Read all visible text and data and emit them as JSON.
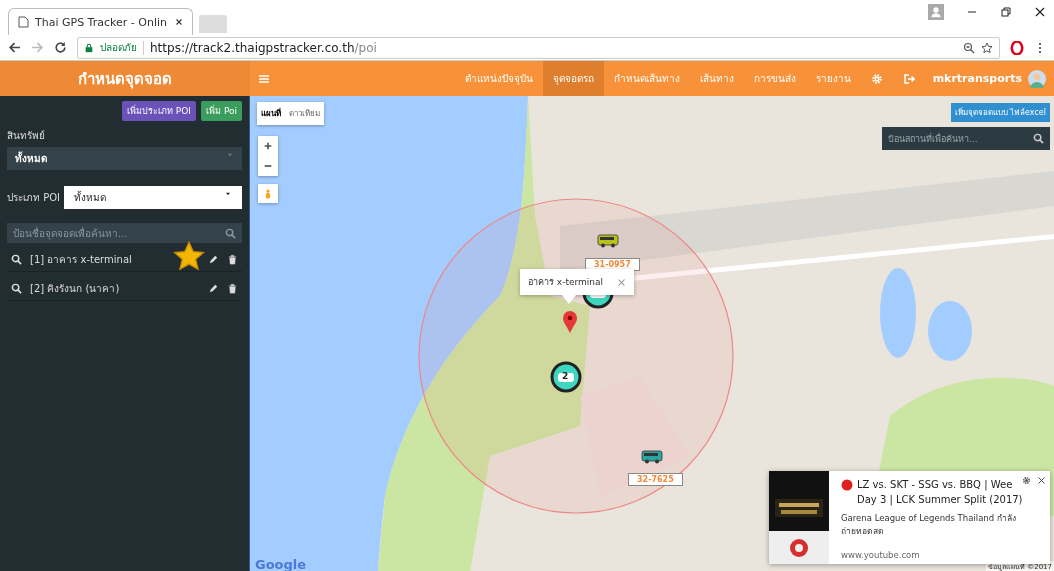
{
  "browser": {
    "tab_title": "Thai GPS Tracker - Onlin",
    "security_label": "ปลอดภัย",
    "url_host": "https://track2.thaigpstracker.co.th",
    "url_path": "/poi"
  },
  "header": {
    "title": "กำหนดจุดจอด",
    "user": "mkrtransports",
    "nav": [
      {
        "label": "ตำแหน่งปัจจุบัน",
        "selected": false
      },
      {
        "label": "จุดจอดรถ",
        "selected": true
      },
      {
        "label": "กำหนดเส้นทาง",
        "selected": false
      },
      {
        "label": "เส้นทาง",
        "selected": false
      },
      {
        "label": "การขนส่ง",
        "selected": false
      },
      {
        "label": "รายงาน",
        "selected": false
      }
    ]
  },
  "sidebar": {
    "buttons": [
      {
        "label": "เพิ่มประเภท POI",
        "color": "#6a52b8"
      },
      {
        "label": "เพิ่ม Poi",
        "color": "#3a9d5d"
      }
    ],
    "asset_label": "สินทรัพย์",
    "asset_value": "ทั้งหมด",
    "poi_type_label": "ประเภท POI",
    "poi_type_value": "ทั้งหมด",
    "search_placeholder": "ป้อนชื่อจุดจอดเพื่อค้นหา...",
    "items": [
      {
        "label": "[1] อาคาร x-terminal",
        "starred": true
      },
      {
        "label": "[2] คิงรังนก (นาคา)",
        "starred": false
      }
    ]
  },
  "map": {
    "type_tabs": [
      {
        "label": "แผนที่",
        "selected": true
      },
      {
        "label": "ดาวเทียม",
        "selected": false
      }
    ],
    "import_button": "เพิ่มจุดจอดแบบ ไฟล์excel",
    "search_placeholder": "ป้อนสถานที่เพื่อค้นหา...",
    "popup": "อาคาร x-terminal",
    "vehicles": [
      {
        "kind": "bus",
        "plate": "31-0957"
      },
      {
        "kind": "car"
      },
      {
        "kind": "car",
        "count": "2"
      },
      {
        "kind": "bus",
        "plate": "32-7625"
      }
    ],
    "logo": "Google",
    "attribution": "ข้อมูลแผนที่ ©2017"
  },
  "notification": {
    "title_lines": [
      "LZ vs. SKT - SSG vs. BBQ | Wee",
      "Day 3 | LCK Summer Split (2017)"
    ],
    "body": "Garena League of Legends Thailand กำลังถ่ายทอดสด",
    "source": "www.youtube.com"
  }
}
